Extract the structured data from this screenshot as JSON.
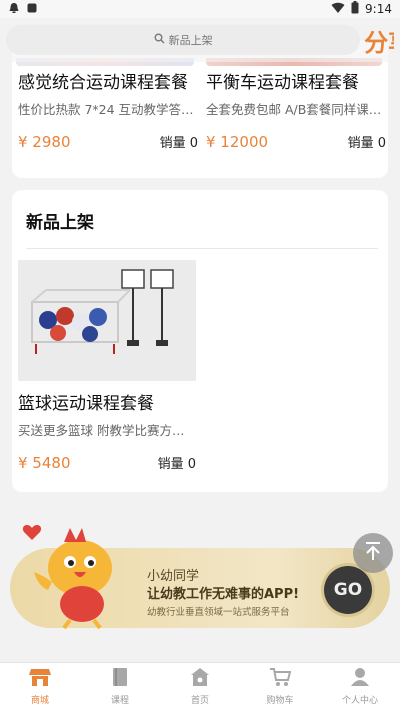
{
  "status_bar": {
    "time": "9:14"
  },
  "search": {
    "placeholder": "新品上架"
  },
  "share_label": "分享",
  "top_products": [
    {
      "title": "感觉统合运动课程套餐",
      "desc": "性价比热款 7*24 互动教学答…",
      "price": "¥ 2980",
      "sales": "销量 0"
    },
    {
      "title": "平衡车运动课程套餐",
      "desc": "全套免费包邮 A/B套餐同样课…",
      "price": "¥ 12000",
      "sales": "销量 0"
    }
  ],
  "new_section": {
    "title": "新品上架",
    "products": [
      {
        "title": "篮球运动课程套餐",
        "desc": "买送更多篮球 附教学比赛方…",
        "price": "¥ 5480",
        "sales": "销量 0"
      }
    ]
  },
  "banner": {
    "line1": "小幼同学",
    "line2": "让幼教工作无难事的APP!",
    "line3": "幼教行业垂直领域一站式服务平台",
    "go": "GO"
  },
  "tabs": [
    {
      "label": "商城",
      "icon": "shop-icon",
      "active": true
    },
    {
      "label": "课程",
      "icon": "book-icon",
      "active": false
    },
    {
      "label": "首页",
      "icon": "home-icon",
      "active": false
    },
    {
      "label": "购物车",
      "icon": "cart-icon",
      "active": false
    },
    {
      "label": "个人中心",
      "icon": "person-icon",
      "active": false
    }
  ],
  "colors": {
    "accent": "#e8833a",
    "background": "#f2f2f2"
  }
}
